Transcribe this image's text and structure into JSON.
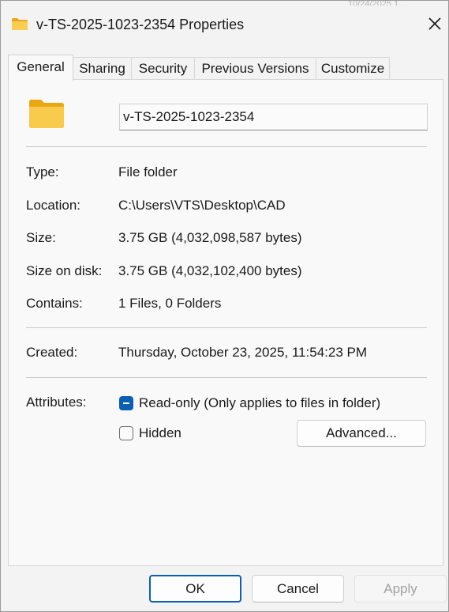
{
  "window": {
    "title": "v-TS-2025-1023-2354 Properties",
    "title_icon": "folder-icon",
    "close_icon": "close-icon",
    "background_artifact": "10/24/2025 1..."
  },
  "tabs": [
    {
      "label": "General",
      "active": true
    },
    {
      "label": "Sharing",
      "active": false
    },
    {
      "label": "Security",
      "active": false
    },
    {
      "label": "Previous Versions",
      "active": false
    },
    {
      "label": "Customize",
      "active": false
    }
  ],
  "general": {
    "folder_icon": "folder-icon",
    "name_value": "v-TS-2025-1023-2354",
    "type": {
      "label": "Type:",
      "value": "File folder"
    },
    "location": {
      "label": "Location:",
      "value": "C:\\Users\\VTS\\Desktop\\CAD"
    },
    "size": {
      "label": "Size:",
      "value": "3.75 GB (4,032,098,587 bytes)"
    },
    "size_on_disk": {
      "label": "Size on disk:",
      "value": "3.75 GB (4,032,102,400 bytes)"
    },
    "contains": {
      "label": "Contains:",
      "value": "1 Files, 0 Folders"
    },
    "created": {
      "label": "Created:",
      "value": "Thursday, October 23, 2025, 11:54:23 PM"
    },
    "attributes": {
      "label": "Attributes:",
      "readonly": {
        "label": "Read-only (Only applies to files in folder)",
        "state": "indeterminate"
      },
      "hidden": {
        "label": "Hidden",
        "state": "unchecked"
      },
      "advanced_label": "Advanced..."
    }
  },
  "footer": {
    "ok_label": "OK",
    "cancel_label": "Cancel",
    "apply_label": "Apply"
  },
  "colors": {
    "accent": "#0a5fb4",
    "folder_yellow": "#f7c948"
  }
}
